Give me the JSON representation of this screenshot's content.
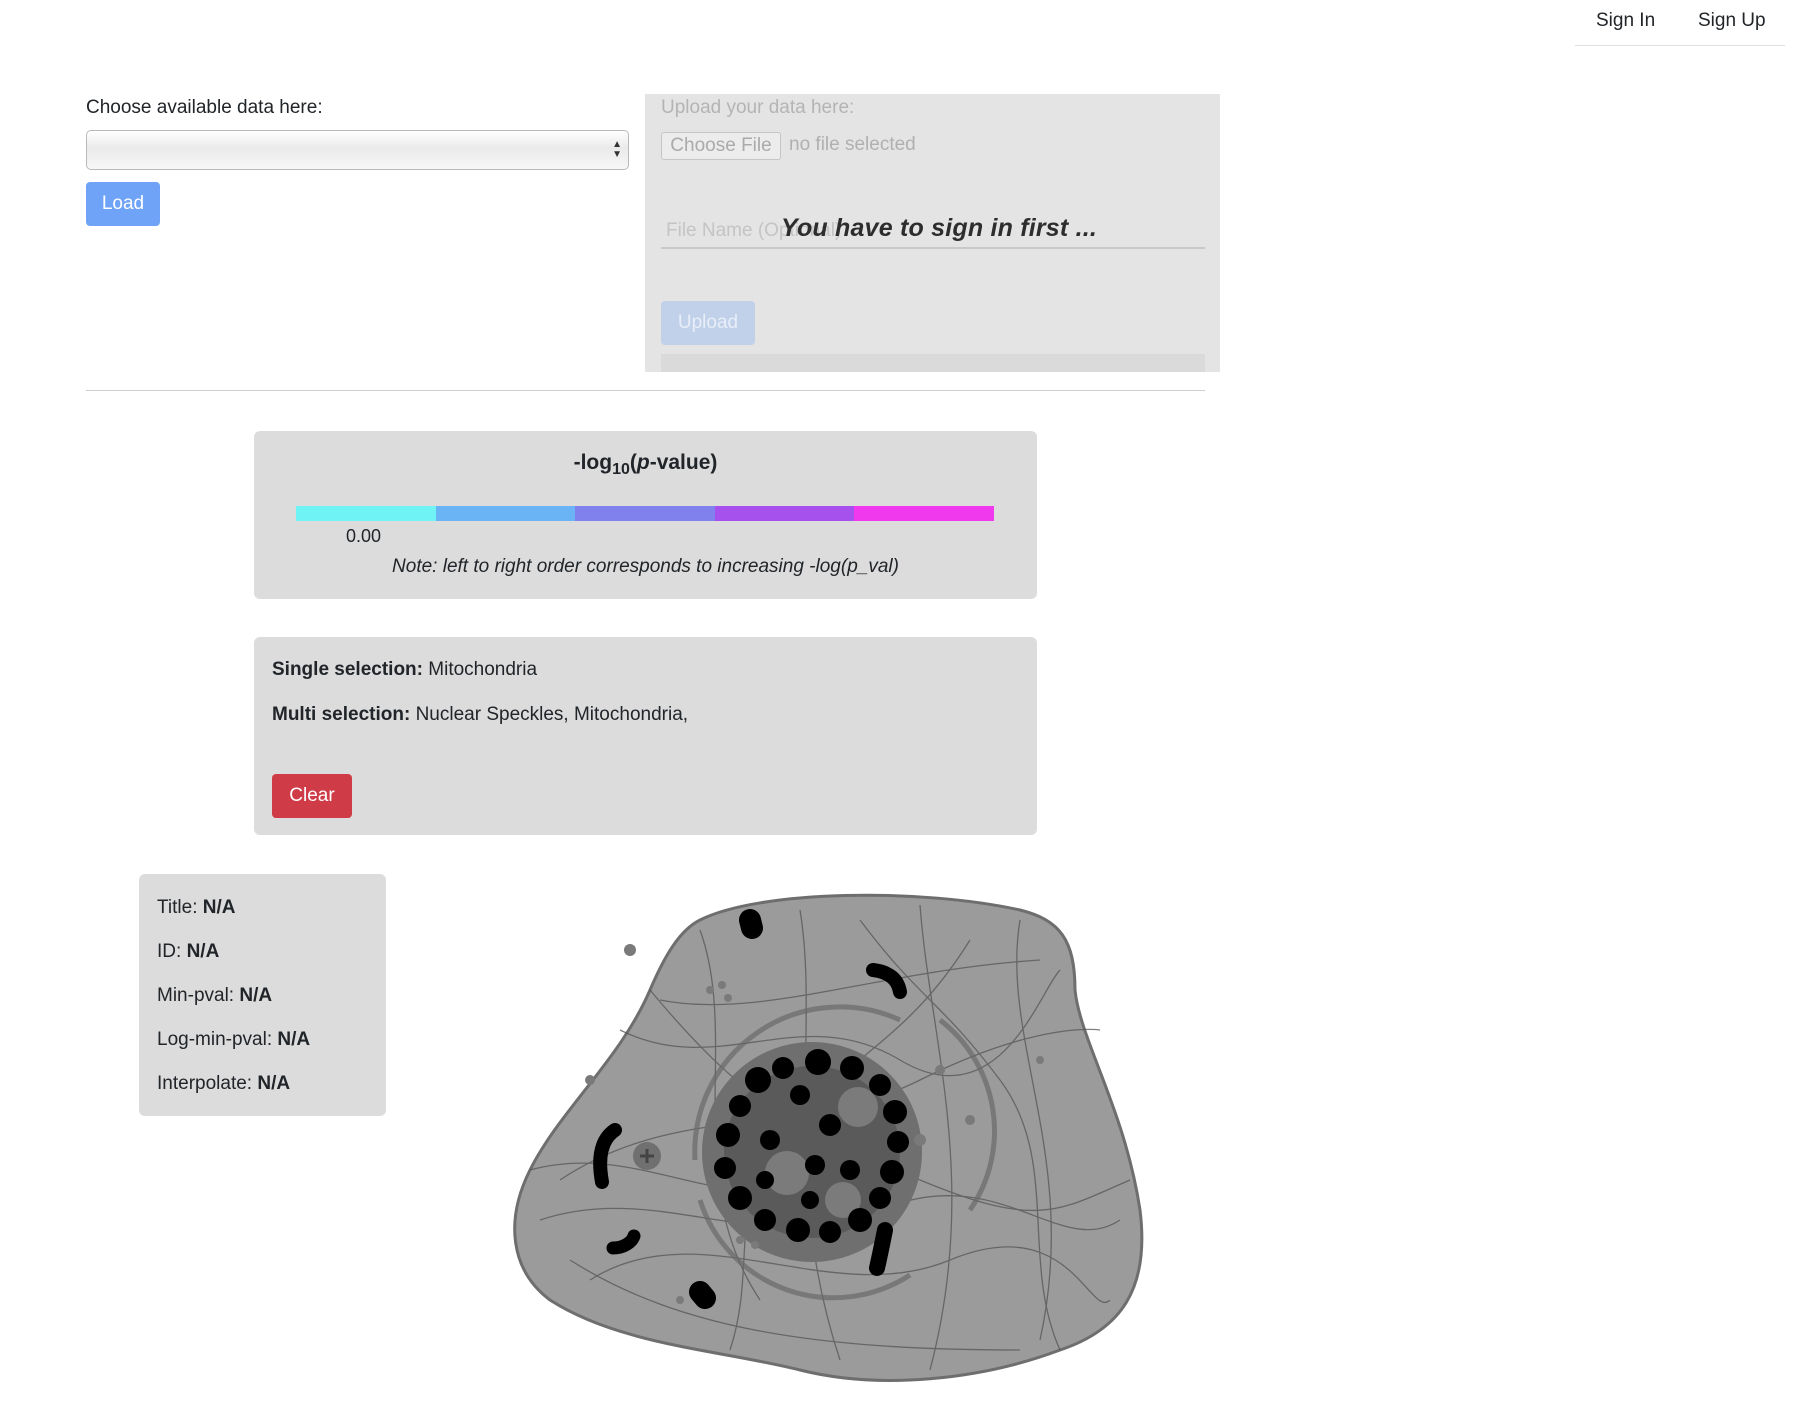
{
  "nav": {
    "sign_in": "Sign In",
    "sign_up": "Sign Up"
  },
  "data_select": {
    "label": "Choose available data here:",
    "selected": "",
    "load_button": "Load"
  },
  "upload": {
    "label": "Upload your data here:",
    "choose_file_button": "Choose File",
    "no_file_text": "no file selected",
    "file_name_placeholder": "File Name (Optional)",
    "signin_overlay": "You have to sign in first ...",
    "upload_button": "Upload"
  },
  "legend": {
    "title_prefix": "-log",
    "title_sub": "10",
    "title_p": "p",
    "title_suffix": "-value)",
    "tick": "0.00",
    "note": "Note: left to right order corresponds to increasing -log(p_val)",
    "colors": [
      "#6ff3f5",
      "#6ab4f5",
      "#8181ee",
      "#a650ee",
      "#f039ec"
    ]
  },
  "selection": {
    "single_label": "Single selection:",
    "single_value": "Mitochondria",
    "multi_label": "Multi selection:",
    "multi_value": "Nuclear Speckles, Mitochondria,",
    "clear_button": "Clear"
  },
  "info": {
    "title_label": "Title:",
    "title_value": "N/A",
    "id_label": "ID:",
    "id_value": "N/A",
    "minpval_label": "Min-pval:",
    "minpval_value": "N/A",
    "logminpval_label": "Log-min-pval:",
    "logminpval_value": "N/A",
    "interpolate_label": "Interpolate:",
    "interpolate_value": "N/A"
  }
}
